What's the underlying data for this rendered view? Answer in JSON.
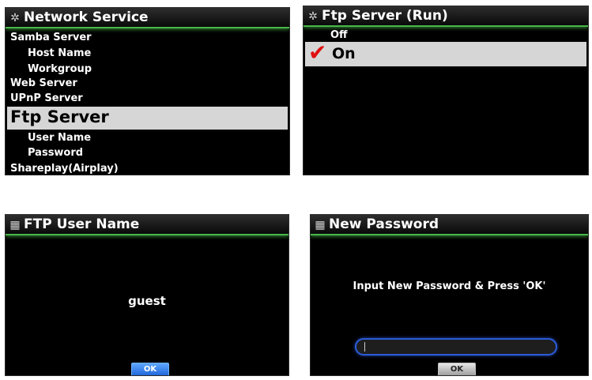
{
  "panel_network": {
    "title": "Network Service",
    "title_icon": "gear-icon",
    "items": [
      {
        "label": "Samba Server"
      },
      {
        "label": "Host Name"
      },
      {
        "label": "Workgroup"
      },
      {
        "label": "Web Server"
      },
      {
        "label": "UPnP Server"
      },
      {
        "label": "Ftp Server"
      },
      {
        "label": "User Name"
      },
      {
        "label": "Password"
      },
      {
        "label": "Shareplay(Airplay)"
      }
    ],
    "selected": "Ftp Server"
  },
  "panel_ftp": {
    "title": "Ftp Server (Run)",
    "title_icon": "gear-icon",
    "options": [
      {
        "label": "Off"
      },
      {
        "label": "On"
      }
    ],
    "selected": "On",
    "check_icon": "checkmark-icon"
  },
  "panel_username": {
    "title": "FTP User Name",
    "title_icon": "grid-icon",
    "value": "guest",
    "ok_label": "OK"
  },
  "panel_password": {
    "title": "New Password",
    "title_icon": "grid-icon",
    "prompt": "Input New Password & Press 'OK'",
    "input_value": "",
    "ok_label": "OK"
  },
  "colors": {
    "title_accent": "#49b649",
    "highlight": "#d6d6d6",
    "check": "#e01010",
    "ok_blue": "#1d63d8",
    "input_border": "#2b5bd8"
  }
}
